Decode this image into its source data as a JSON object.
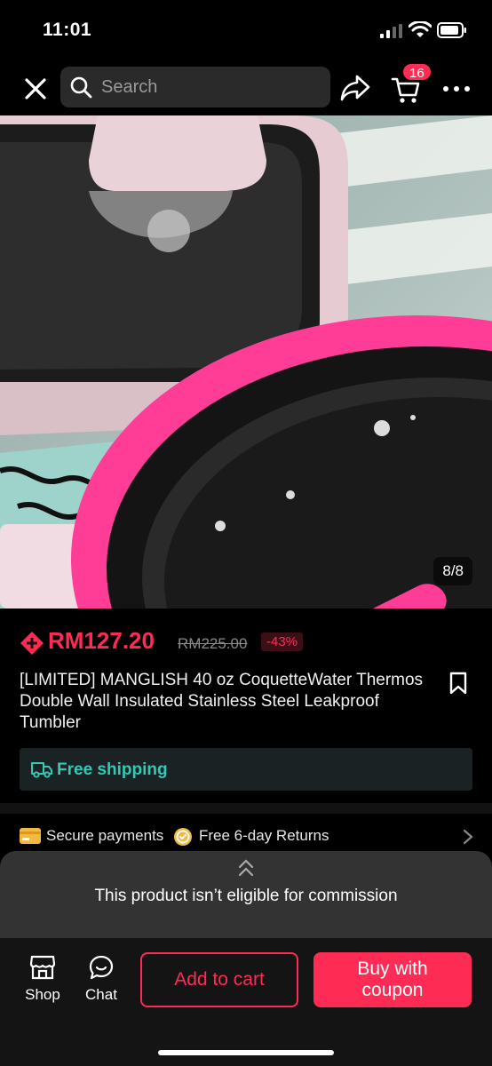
{
  "status_bar": {
    "time": "11:01",
    "icons": [
      "cellular-signal-icon",
      "wifi-icon",
      "battery-icon"
    ]
  },
  "top_nav": {
    "search_placeholder": "Search",
    "cart_count": "16",
    "icons": [
      "close-icon",
      "search-icon",
      "share-icon",
      "cart-icon",
      "more-icon"
    ]
  },
  "gallery": {
    "counter": "8/8"
  },
  "product": {
    "price": "RM127.20",
    "original_price": "RM225.00",
    "discount": "-43%",
    "title": "[LIMITED] MANGLISH 40 oz CoquetteWater Thermos Double Wall Insulated Stainless Steel Leakproof Tumbler",
    "shipping": "Free shipping"
  },
  "assurance": {
    "secure_payments": "Secure payments",
    "returns": "Free 6-day Returns"
  },
  "commission_sheet": {
    "message": "This product isn’t eligible for commission"
  },
  "bottom_bar": {
    "shop_label": "Shop",
    "chat_label": "Chat",
    "add_to_cart": "Add to cart",
    "buy_with_coupon": "Buy with coupon"
  },
  "colors": {
    "accent": "#fe2c55",
    "shipping_teal": "#33c9b5",
    "background": "#000000",
    "sheet": "#333333"
  }
}
